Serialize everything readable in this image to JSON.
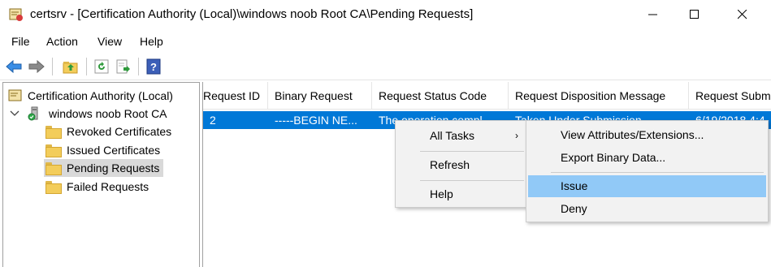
{
  "window": {
    "title": "certsrv - [Certification Authority (Local)\\windows noob Root CA\\Pending Requests]",
    "minimize": "—",
    "maximize": "☐",
    "close": "✕"
  },
  "menubar": [
    "File",
    "Action",
    "View",
    "Help"
  ],
  "toolbar": {
    "icons": [
      "back-arrow-icon",
      "forward-arrow-icon",
      "up-folder-icon",
      "refresh-icon",
      "export-list-icon",
      "help-icon"
    ]
  },
  "tree": {
    "root": "Certification Authority (Local)",
    "ca": "windows noob Root CA",
    "folders": [
      "Revoked Certificates",
      "Issued Certificates",
      "Pending Requests",
      "Failed Requests"
    ],
    "selected": "Pending Requests"
  },
  "list": {
    "columns": [
      "Request ID",
      "Binary Request",
      "Request Status Code",
      "Request Disposition Message",
      "Request Submission Date"
    ],
    "row": {
      "request_id": "2",
      "binary_request": "-----BEGIN NE...",
      "status_code": "The operation compl...",
      "disposition": "Taken Under Submission",
      "submission_date": "6/19/2018 4:4"
    }
  },
  "context_menu": {
    "items": [
      "All Tasks",
      "Refresh",
      "Help"
    ],
    "submenu_arrow": "›"
  },
  "submenu": {
    "items": [
      "View Attributes/Extensions...",
      "Export Binary Data...",
      "Issue",
      "Deny"
    ],
    "highlighted": "Issue"
  },
  "colors": {
    "selection": "#0078d7",
    "menu_hover": "#91c9f7",
    "tree_selected": "#d9d9d9"
  }
}
